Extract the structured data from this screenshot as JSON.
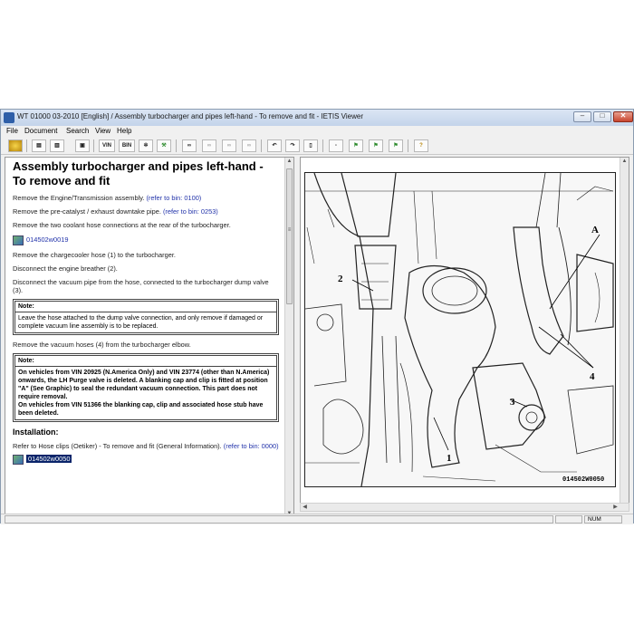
{
  "window": {
    "title": "WT 01000 03-2010 [English] / Assembly turbocharger and pipes left-hand - To remove and fit - IETIS Viewer",
    "controls": {
      "minimize": "‒",
      "maximize": "□",
      "close": "✕"
    }
  },
  "menu": [
    "File",
    "Document",
    "Search",
    "View",
    "Help"
  ],
  "toolbar": {
    "vin_label": "VIN",
    "bin_label": "BIN"
  },
  "document": {
    "title": "Assembly turbocharger and pipes left-hand - To remove and fit",
    "steps": [
      {
        "text": "Remove the Engine/Transmission assembly. ",
        "link": "(refer to bin: 0100)"
      },
      {
        "text": "Remove the pre-catalyst / exhaust downtake pipe. ",
        "link": "(refer to bin: 0253)"
      },
      {
        "text": "Remove the two coolant hose connections at the rear of the turbocharger."
      }
    ],
    "image_link_1": "014502w0019",
    "steps2": [
      {
        "text": "Remove the chargecooler hose (1) to the turbocharger."
      },
      {
        "text": "Disconnect the engine breather (2)."
      },
      {
        "text": "Disconnect the vacuum pipe from the hose, connected to the turbocharger dump valve (3)."
      }
    ],
    "note1": {
      "head": "Note:",
      "body": "Leave the hose attached to the dump valve connection, and only remove if damaged or complete vacuum line assembly is to be replaced."
    },
    "step_vacuum": "Remove the vacuum hoses (4) from the turbocharger elbow.",
    "note2": {
      "head": "Note:",
      "body1": "On vehicles from VIN 20925 (N.America Only) and VIN 23774 (other than N.America) onwards, the LH Purge valve is deleted. A blanking cap and clip is fitted at position \"A\" (See Graphic) to seal the redundant vacuum connection. This part does not require removal.",
      "body2": "On vehicles from VIN 51366 the blanking cap, clip and associated hose stub have been deleted."
    },
    "installation_heading": "Installation:",
    "install_text": "Refer to Hose clips (Oetiker) - To remove and fit (General Information). ",
    "install_link": "(refer to bin: 0000)",
    "image_link_2": "014502w0050"
  },
  "diagram": {
    "callouts": [
      "A",
      "2",
      "4",
      "3",
      "1"
    ],
    "figure_code": "014502W0050"
  },
  "status": {
    "num": "NUM"
  },
  "scroll": {
    "up": "▲",
    "down": "▼",
    "left": "◀",
    "right": "▶",
    "grip": "≡"
  }
}
